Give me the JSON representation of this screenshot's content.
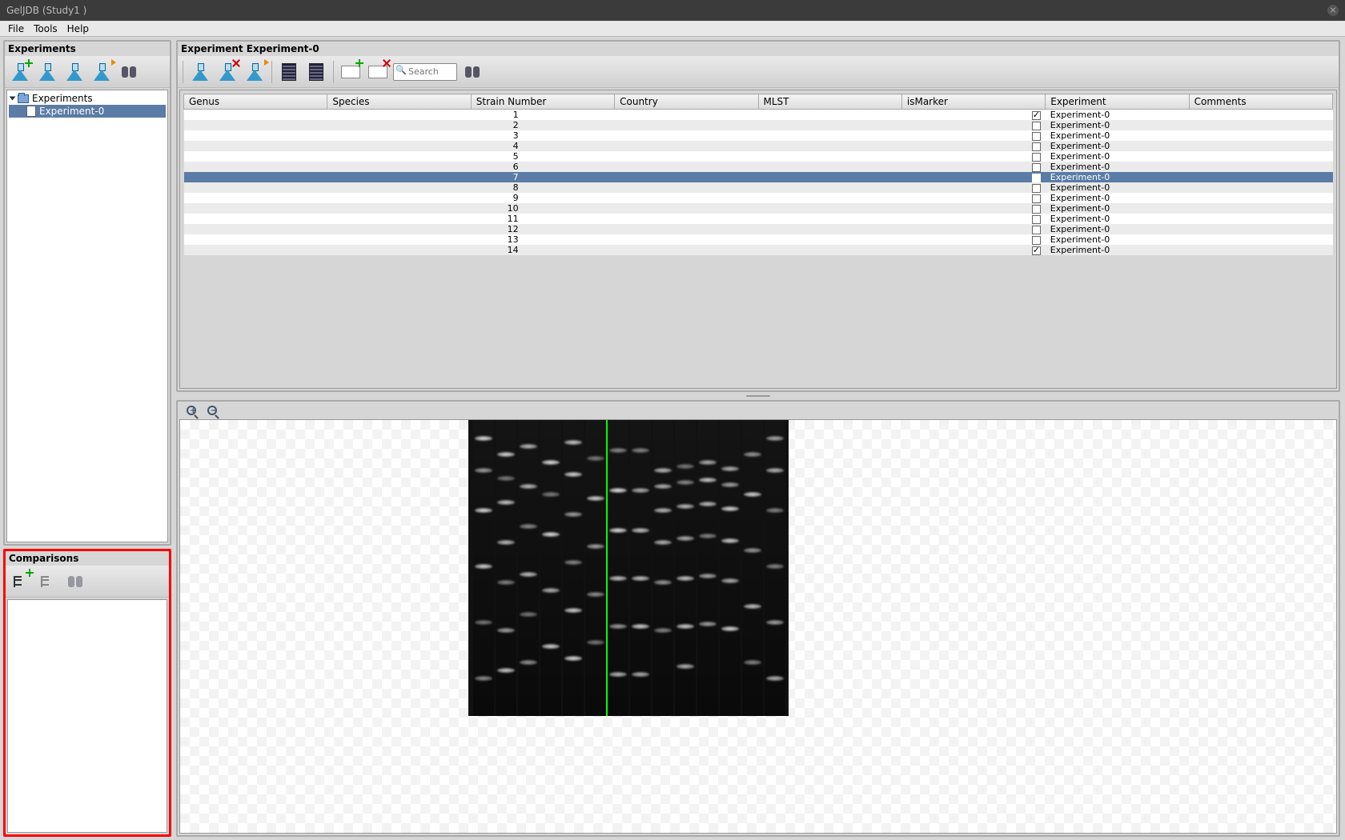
{
  "window": {
    "title": "GelJDB (Study1 )"
  },
  "menubar": {
    "file": "File",
    "tools": "Tools",
    "help": "Help"
  },
  "experiments_panel": {
    "title": "Experiments",
    "tree_root": "Experiments",
    "tree_item": "Experiment-0"
  },
  "comparisons_panel": {
    "title": "Comparisons"
  },
  "detail_panel": {
    "title": "Experiment Experiment-0",
    "search_placeholder": "Search",
    "columns": [
      "Genus",
      "Species",
      "Strain Number",
      "Country",
      "MLST",
      "isMarker",
      "Experiment",
      "Comments"
    ],
    "rows": [
      {
        "strain": "1",
        "isMarker": true,
        "experiment": "Experiment-0"
      },
      {
        "strain": "2",
        "isMarker": false,
        "experiment": "Experiment-0"
      },
      {
        "strain": "3",
        "isMarker": false,
        "experiment": "Experiment-0"
      },
      {
        "strain": "4",
        "isMarker": false,
        "experiment": "Experiment-0"
      },
      {
        "strain": "5",
        "isMarker": false,
        "experiment": "Experiment-0"
      },
      {
        "strain": "6",
        "isMarker": false,
        "experiment": "Experiment-0"
      },
      {
        "strain": "7",
        "isMarker": false,
        "experiment": "Experiment-0",
        "selected": true
      },
      {
        "strain": "8",
        "isMarker": false,
        "experiment": "Experiment-0"
      },
      {
        "strain": "9",
        "isMarker": false,
        "experiment": "Experiment-0"
      },
      {
        "strain": "10",
        "isMarker": false,
        "experiment": "Experiment-0"
      },
      {
        "strain": "11",
        "isMarker": false,
        "experiment": "Experiment-0"
      },
      {
        "strain": "12",
        "isMarker": false,
        "experiment": "Experiment-0"
      },
      {
        "strain": "13",
        "isMarker": false,
        "experiment": "Experiment-0"
      },
      {
        "strain": "14",
        "isMarker": true,
        "experiment": "Experiment-0"
      }
    ]
  }
}
